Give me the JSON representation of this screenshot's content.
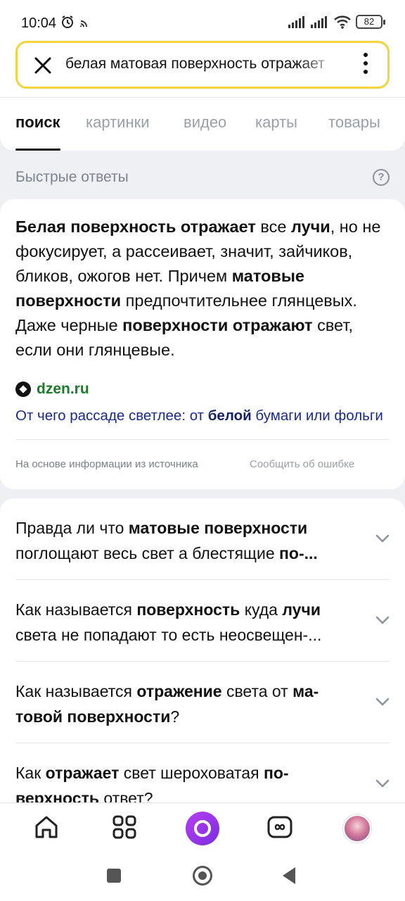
{
  "status_bar": {
    "time": "10:04",
    "battery": "82"
  },
  "search": {
    "query": "белая матовая поверхность отражает"
  },
  "tabs": [
    {
      "label": "поиск",
      "active": true
    },
    {
      "label": "картинки",
      "active": false
    },
    {
      "label": "видео",
      "active": false
    },
    {
      "label": "карты",
      "active": false
    },
    {
      "label": "товары",
      "active": false
    }
  ],
  "quick_answers": {
    "header": "Быстрые ответы",
    "help": "?",
    "answer": {
      "segments": [
        {
          "t": "Белая поверхность отражает",
          "b": true
        },
        {
          "t": " все ",
          "b": false
        },
        {
          "t": "лучи",
          "b": true
        },
        {
          "t": ", но не фокусирует, а рассеивает, значит, зайчиков, бликов, ожогов нет. Причем ",
          "b": false
        },
        {
          "t": "матовые поверхности",
          "b": true
        },
        {
          "t": " предпочтительнее глянцевых. Даже черные ",
          "b": false
        },
        {
          "t": "поверхности отражают",
          "b": true
        },
        {
          "t": " свет, если они глянцевые.",
          "b": false
        }
      ]
    },
    "source": {
      "name": "dzen.ru",
      "link_segments": [
        {
          "t": "От чего рассаде светлее: от ",
          "b": false
        },
        {
          "t": "белой",
          "b": true
        },
        {
          "t": " бумаги или фольги",
          "b": false
        }
      ]
    },
    "footer_left": "На основе информации из источника",
    "footer_right": "Сообщить об ошибке"
  },
  "questions": [
    {
      "line1": [
        {
          "t": "Правда ли что ",
          "b": false
        },
        {
          "t": "матовые поверхности",
          "b": true
        }
      ],
      "line2": [
        {
          "t": "поглощают весь свет а блестящие ",
          "b": false
        },
        {
          "t": "по-...",
          "b": true
        }
      ]
    },
    {
      "line1": [
        {
          "t": "Как называется ",
          "b": false
        },
        {
          "t": "поверхность",
          "b": true
        },
        {
          "t": " куда ",
          "b": false
        },
        {
          "t": "лучи",
          "b": true
        }
      ],
      "line2": [
        {
          "t": "света не попадают то есть неосвещен-...",
          "b": false
        }
      ]
    },
    {
      "line1": [
        {
          "t": "Как называется ",
          "b": false
        },
        {
          "t": "отражение",
          "b": true
        },
        {
          "t": " света от ",
          "b": false
        },
        {
          "t": "ма-",
          "b": true
        }
      ],
      "line2": [
        {
          "t": "товой поверхности",
          "b": true
        },
        {
          "t": "?",
          "b": false
        }
      ]
    },
    {
      "line1": [
        {
          "t": "Как ",
          "b": false
        },
        {
          "t": "отражает",
          "b": true
        },
        {
          "t": " свет шероховатая ",
          "b": false
        },
        {
          "t": "по-",
          "b": true
        }
      ],
      "line2": [
        {
          "t": "верхность",
          "b": true
        },
        {
          "t": " ответ?",
          "b": false
        }
      ]
    }
  ],
  "bottom_nav": {
    "items": [
      "home-icon",
      "apps-grid-icon",
      "alice-assistant-icon",
      "tabs-switcher-icon",
      "avatar"
    ]
  },
  "colors": {
    "search_border": "#f3d33e",
    "alice": "#9b35ea",
    "source_green": "#1d7a2b",
    "link_blue": "#1a2a8c"
  }
}
